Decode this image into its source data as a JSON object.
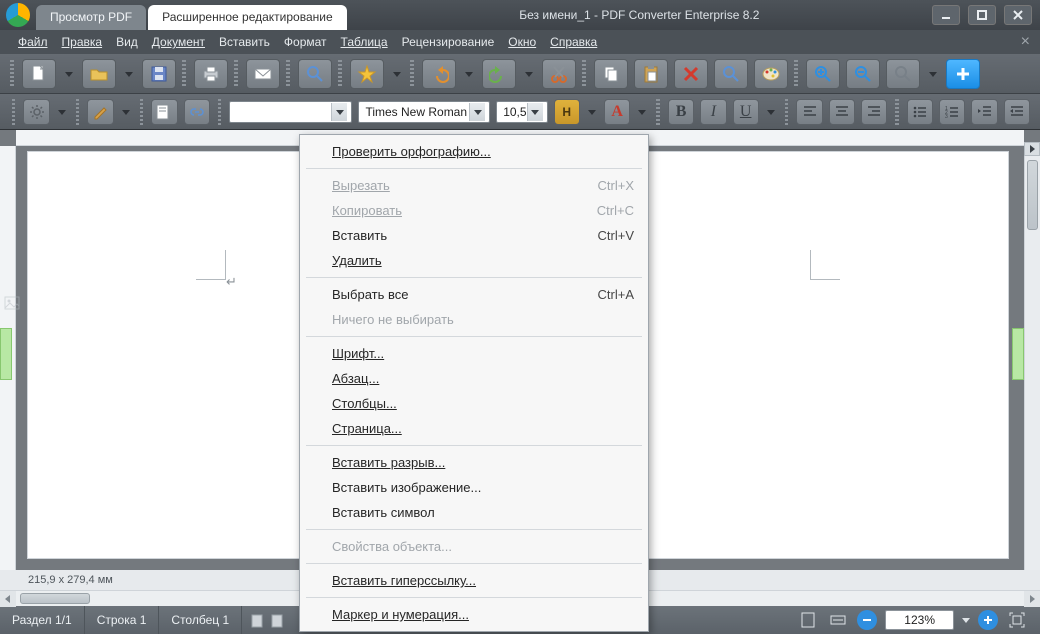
{
  "titlebar": {
    "tabs": {
      "view": "Просмотр PDF",
      "edit": "Расширенное редактирование"
    },
    "title": "Без имени_1 - PDF Converter Enterprise 8.2"
  },
  "menubar": {
    "file": "Файл",
    "edit": "Правка",
    "view": "Вид",
    "document": "Документ",
    "insert": "Вставить",
    "format": "Формат",
    "table": "Таблица",
    "review": "Рецензирование",
    "window": "Окно",
    "help": "Справка"
  },
  "toolbar2": {
    "style_placeholder": "",
    "font": "Times New Roman",
    "size": "10,5"
  },
  "context_menu": {
    "spellcheck": "Проверить орфографию...",
    "cut": "Вырезать",
    "cut_sc": "Ctrl+X",
    "copy": "Копировать",
    "copy_sc": "Ctrl+C",
    "paste": "Вставить",
    "paste_sc": "Ctrl+V",
    "delete": "Удалить",
    "select_all": "Выбрать все",
    "select_all_sc": "Ctrl+A",
    "select_none": "Ничего не выбирать",
    "font": "Шрифт...",
    "paragraph": "Абзац...",
    "columns": "Столбцы...",
    "page": "Страница...",
    "break": "Вставить разрыв...",
    "image": "Вставить изображение...",
    "symbol": "Вставить символ",
    "object_props": "Свойства объекта...",
    "hyperlink": "Вставить гиперссылку...",
    "bullets": "Маркер и нумерация..."
  },
  "infostrip": {
    "coords": "215,9 x 279,4 мм"
  },
  "statusbar": {
    "section": "Раздел 1/1",
    "row": "Строка 1",
    "column": "Столбец 1",
    "zoom": "123%"
  },
  "colors": {
    "accent_blue": "#2f8fe0",
    "accent_green": "#b8e8a4"
  }
}
